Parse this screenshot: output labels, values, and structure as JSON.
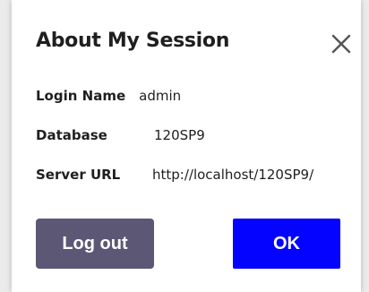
{
  "dialog": {
    "title": "About My Session",
    "close_icon": "close-icon"
  },
  "fields": [
    {
      "label": "Login Name",
      "value": "admin"
    },
    {
      "label": "Database",
      "value": "120SP9"
    },
    {
      "label": "Server URL",
      "value": "http://localhost/120SP9/"
    }
  ],
  "buttons": {
    "logout_label": "Log out",
    "ok_label": "OK"
  },
  "colors": {
    "logout_bg": "#5b5774",
    "ok_bg": "#0303ff",
    "text": "#1f1f1f"
  }
}
